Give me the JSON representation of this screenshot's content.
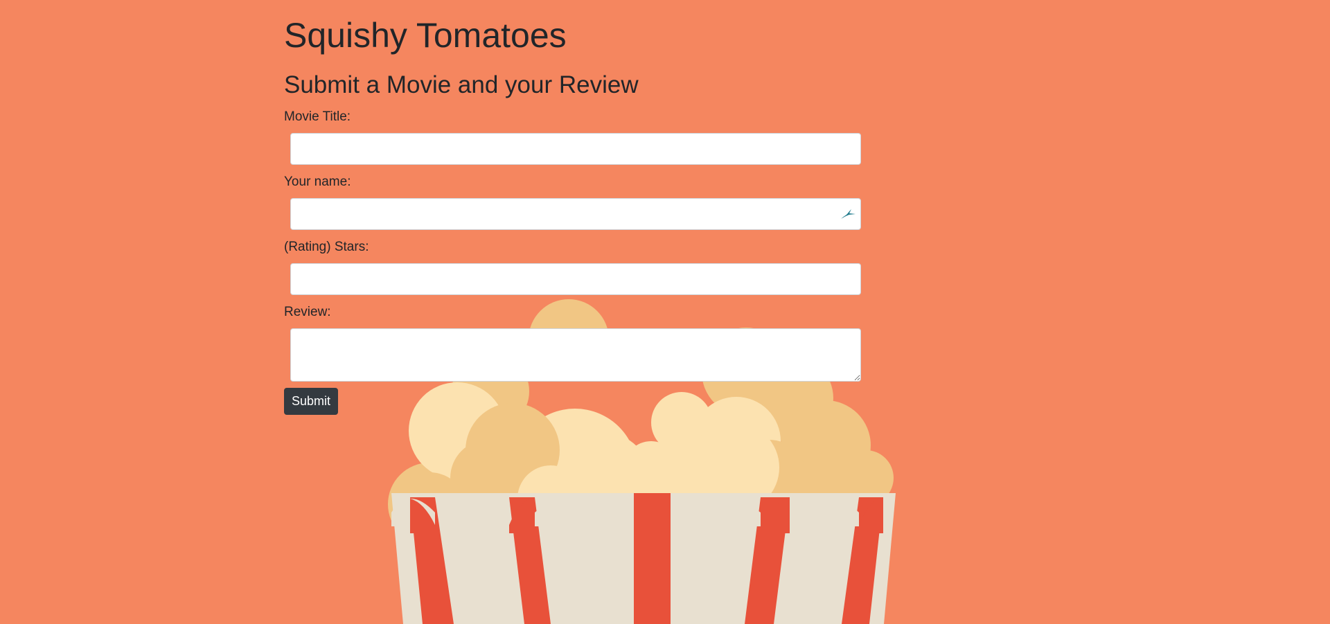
{
  "app": {
    "title": "Squishy Tomatoes"
  },
  "form": {
    "heading": "Submit a Movie and your Review",
    "fields": {
      "movie_title": {
        "label": "Movie Title:",
        "value": ""
      },
      "your_name": {
        "label": "Your name:",
        "value": ""
      },
      "stars": {
        "label": "(Rating) Stars:",
        "value": ""
      },
      "review": {
        "label": "Review:",
        "value": ""
      }
    },
    "submit_label": "Submit"
  },
  "colors": {
    "background": "#F5865F",
    "button": "#343a40",
    "popcorn_light": "#FCE2B0",
    "popcorn_dark": "#F1C684",
    "box_white": "#E8E0D0",
    "box_red": "#E8513A"
  },
  "icons": {
    "name_field_icon": "password-manager-icon",
    "background_art": "popcorn-illustration"
  }
}
